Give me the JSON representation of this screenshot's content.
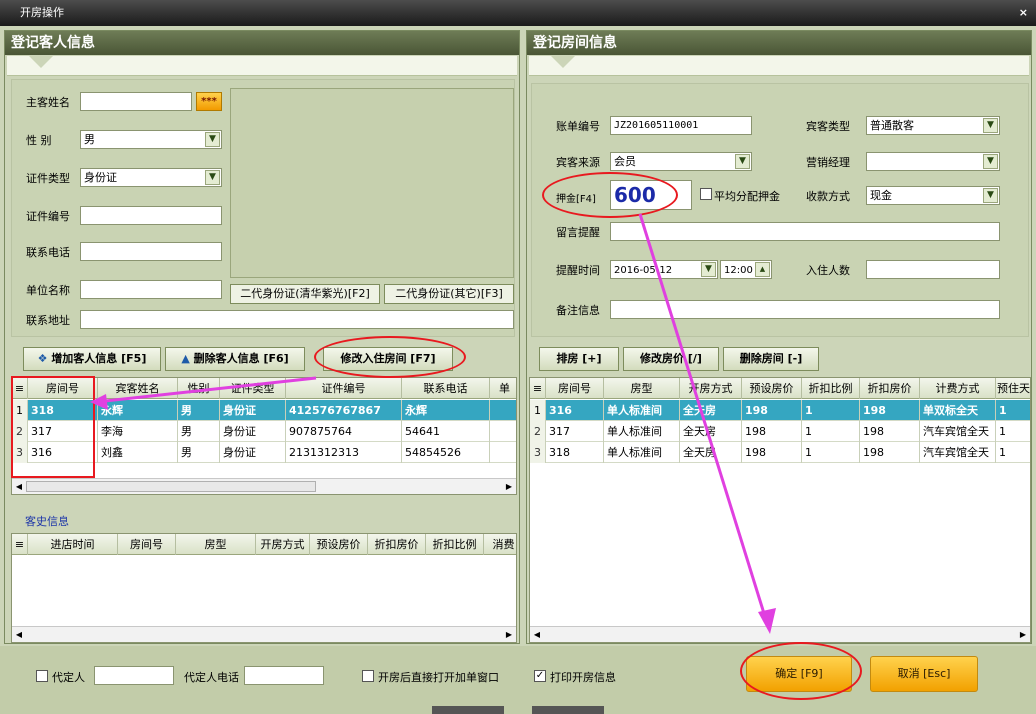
{
  "window": {
    "title": "开房操作",
    "close": "×"
  },
  "guest_panel": {
    "title": "登记客人信息",
    "host_name_label": "主客姓名",
    "host_name_value": "",
    "lookup_button": "***",
    "gender_label": "性    别",
    "gender_value": "男",
    "id_type_label": "证件类型",
    "id_type_value": "身份证",
    "id_no_label": "证件编号",
    "id_no_value": "",
    "phone_label": "联系电话",
    "phone_value": "",
    "company_label": "单位名称",
    "company_value": "",
    "address_label": "联系地址",
    "address_value": "",
    "id_reader_1": "二代身份证(清华紫光)[F2]",
    "id_reader_2": "二代身份证(其它)[F3]",
    "add_guest": "增加客人信息 [F5]",
    "delete_guest": "删除客人信息 [F6]",
    "modify_room": "修改入住房间 [F7]"
  },
  "guest_table": {
    "headers": [
      "房间号",
      "宾客姓名",
      "性别",
      "证件类型",
      "证件编号",
      "联系电话",
      "单"
    ],
    "rows": [
      {
        "n": "1",
        "room": "318",
        "name": "永辉",
        "sex": "男",
        "idtype": "身份证",
        "idno": "412576767867",
        "phone": "永辉"
      },
      {
        "n": "2",
        "room": "317",
        "name": "李海",
        "sex": "男",
        "idtype": "身份证",
        "idno": "907875764",
        "phone": "54641"
      },
      {
        "n": "3",
        "room": "316",
        "name": "刘鑫",
        "sex": "男",
        "idtype": "身份证",
        "idno": "2131312313",
        "phone": "54854526"
      }
    ]
  },
  "history": {
    "title": "客史信息",
    "headers": [
      "进店时间",
      "房间号",
      "房型",
      "开房方式",
      "预设房价",
      "折扣房价",
      "折扣比例",
      "消费"
    ]
  },
  "room_panel": {
    "title": "登记房间信息",
    "bill_no_label": "账单编号",
    "bill_no_value": "JZ201605110001",
    "guest_type_label": "宾客类型",
    "guest_type_value": "普通散客",
    "source_label": "宾客来源",
    "source_value": "会员",
    "manager_label": "营销经理",
    "manager_value": "",
    "deposit_label": "押金[F4]",
    "deposit_value": "600",
    "split_deposit": "平均分配押金",
    "pay_label": "收款方式",
    "pay_value": "现金",
    "message_label": "留言提醒",
    "message_value": "",
    "remind_label": "提醒时间",
    "remind_date": "2016-05-12",
    "remind_time": "12:00",
    "people_label": "入住人数",
    "people_value": "",
    "note_label": "备注信息",
    "note_value": "",
    "arrange_room": "排房 [+]",
    "modify_price": "修改房价 [/]",
    "delete_room": "删除房间 [-]"
  },
  "room_table": {
    "headers": [
      "房间号",
      "房型",
      "开房方式",
      "预设房价",
      "折扣比例",
      "折扣房价",
      "计费方式",
      "预住天"
    ],
    "rows": [
      {
        "n": "1",
        "room": "316",
        "type": "单人标准间",
        "mode": "全天房",
        "price": "198",
        "ratio": "1",
        "dprice": "198",
        "billing": "单双标全天",
        "days": "1"
      },
      {
        "n": "2",
        "room": "317",
        "type": "单人标准间",
        "mode": "全天房",
        "price": "198",
        "ratio": "1",
        "dprice": "198",
        "billing": "汽车宾馆全天",
        "days": "1"
      },
      {
        "n": "3",
        "room": "318",
        "type": "单人标准间",
        "mode": "全天房",
        "price": "198",
        "ratio": "1",
        "dprice": "198",
        "billing": "汽车宾馆全天",
        "days": "1"
      }
    ]
  },
  "footer": {
    "agent_label": "代定人",
    "agent_phone_label": "代定人电话",
    "open_bill_label": "开房后直接打开加单窗口",
    "print_label": "打印开房信息",
    "ok": "确定 [F9]",
    "cancel": "取消 [Esc]"
  }
}
